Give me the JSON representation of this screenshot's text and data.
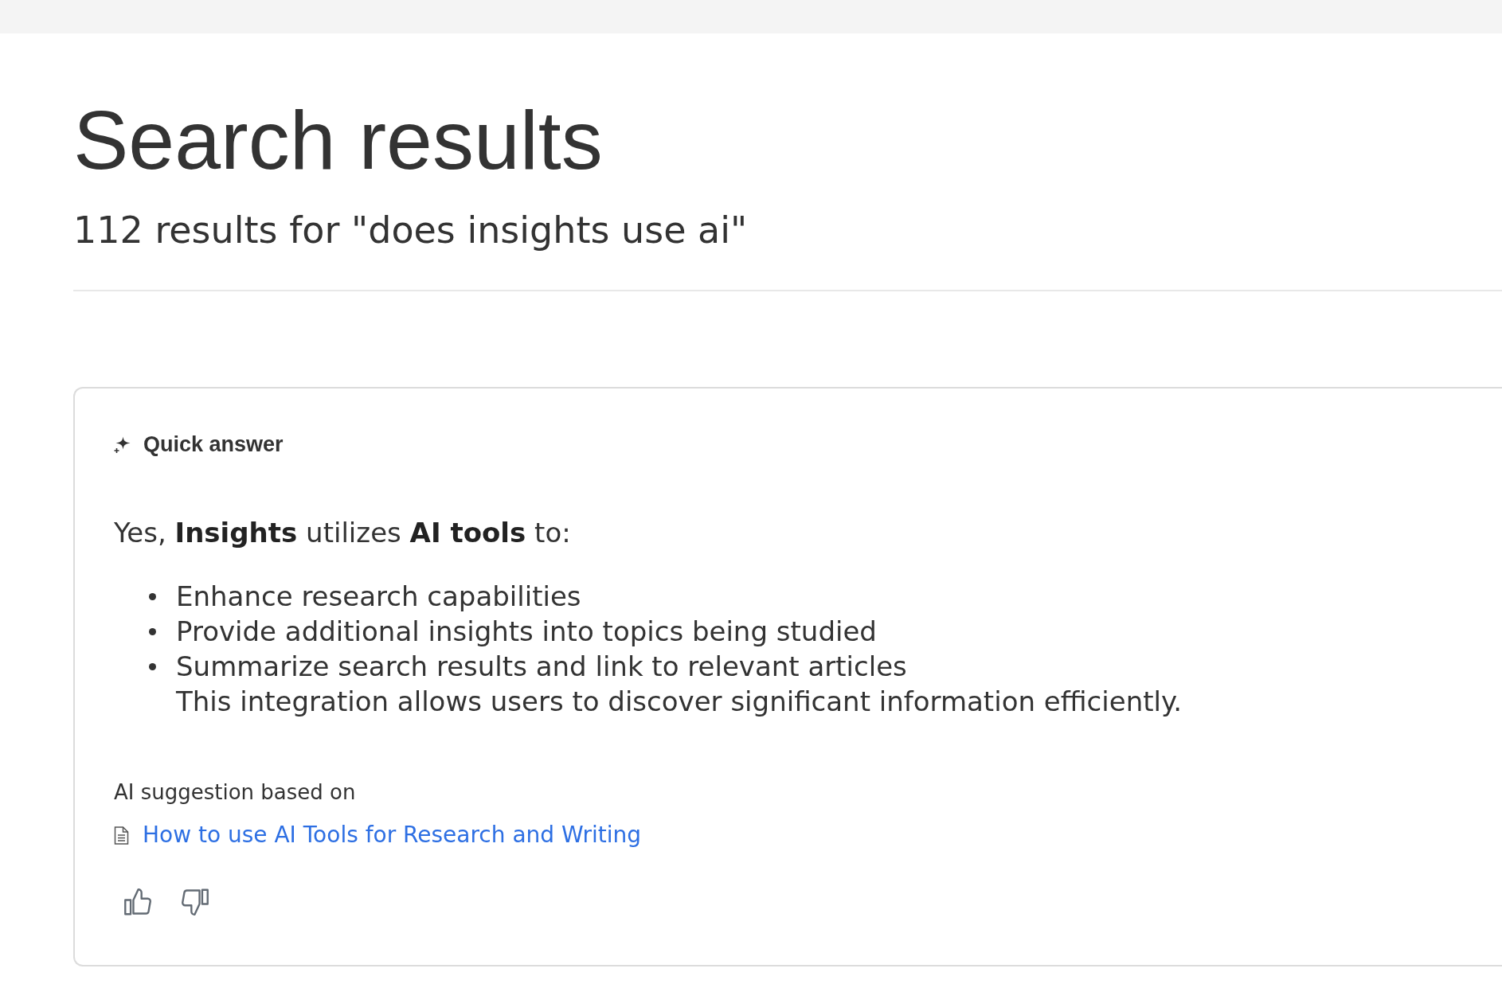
{
  "page": {
    "title": "Search results",
    "result_summary": "112 results for \"does insights use ai\""
  },
  "quick_answer": {
    "heading": "Quick answer",
    "intro": "Yes, **Insights** utilizes **AI tools** to:",
    "bullets": [
      "Enhance research capabilities",
      "Provide additional insights into topics being studied",
      "Summarize search results and link to relevant articles"
    ],
    "after_list": "This integration allows users to discover significant information efficiently.",
    "sources_label": "AI suggestion based on",
    "sources": [
      {
        "title": "How to use AI Tools for Research and Writing"
      }
    ]
  }
}
